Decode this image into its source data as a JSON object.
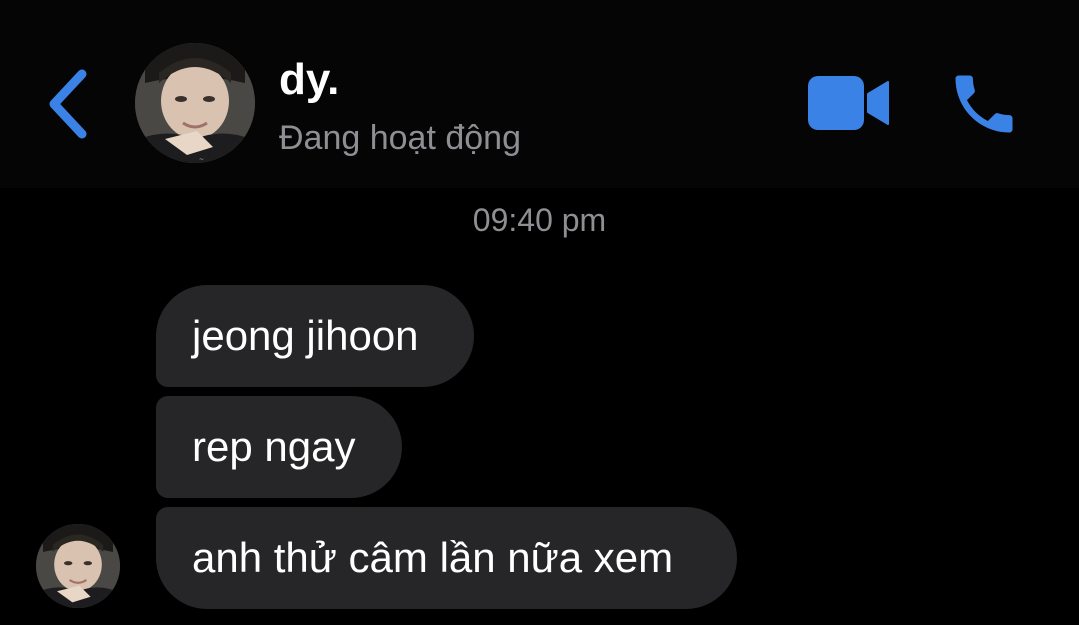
{
  "header": {
    "back_icon": "chevron-left-icon",
    "contact_name": "dy.",
    "status": "Đang hoạt động",
    "video_icon": "video-camera-icon",
    "call_icon": "phone-icon",
    "accent_color": "#3b82e6"
  },
  "chat": {
    "timestamp": "09:40 pm",
    "messages": [
      {
        "text": "jeong jihoon",
        "direction": "incoming"
      },
      {
        "text": "rep ngay",
        "direction": "incoming"
      },
      {
        "text": "anh thử câm lần nữa xem",
        "direction": "incoming"
      }
    ],
    "bubble_color": "#262628",
    "background_color": "#000000"
  }
}
